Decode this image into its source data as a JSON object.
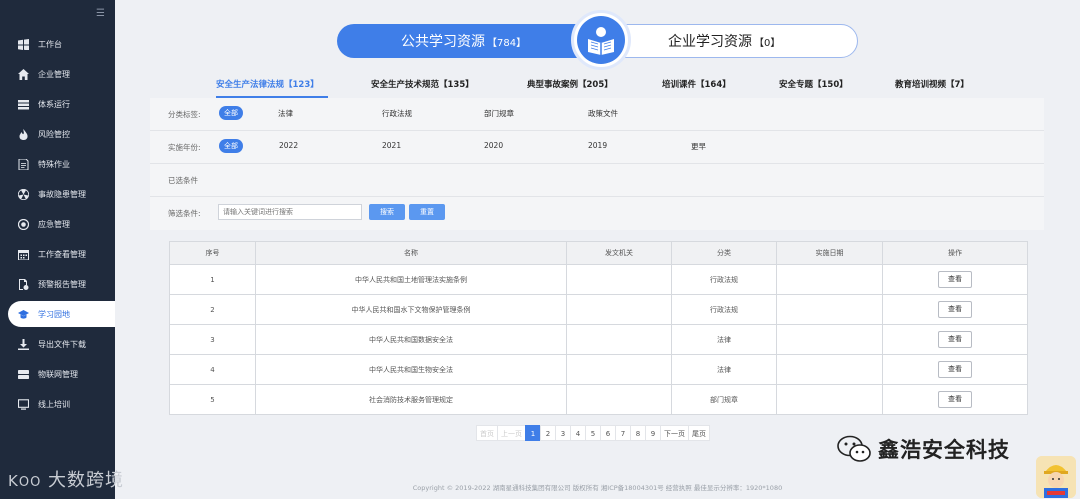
{
  "sidebar": {
    "items": [
      {
        "label": "工作台",
        "icon": "windows-icon"
      },
      {
        "label": "企业管理",
        "icon": "home-icon"
      },
      {
        "label": "体系运行",
        "icon": "stack-icon"
      },
      {
        "label": "风险管控",
        "icon": "fire-icon"
      },
      {
        "label": "特殊作业",
        "icon": "document-icon"
      },
      {
        "label": "事故隐患管理",
        "icon": "radiation-icon"
      },
      {
        "label": "应急管理",
        "icon": "target-icon"
      },
      {
        "label": "工作查看管理",
        "icon": "calendar-icon"
      },
      {
        "label": "预警报告管理",
        "icon": "report-icon"
      },
      {
        "label": "学习园地",
        "icon": "graduation-cap-icon",
        "active": true
      },
      {
        "label": "导出文件下载",
        "icon": "download-icon"
      },
      {
        "label": "物联网管理",
        "icon": "storage-icon"
      },
      {
        "label": "线上培训",
        "icon": "monitor-icon"
      }
    ]
  },
  "switcher": {
    "public_label": "公共学习资源",
    "public_count": "【784】",
    "enterprise_label": "企业学习资源",
    "enterprise_count": "【0】"
  },
  "tabs": [
    {
      "label": "安全生产法律法规【123】",
      "active": true
    },
    {
      "label": "安全生产技术规范【135】"
    },
    {
      "label": "典型事故案例【205】"
    },
    {
      "label": "培训课件【164】"
    },
    {
      "label": "安全专题【150】"
    },
    {
      "label": "教育培训视频【7】"
    }
  ],
  "filters": {
    "category_label": "分类标签:",
    "category_all": "全部",
    "category_options": [
      "法律",
      "行政法规",
      "部门规章",
      "政策文件"
    ],
    "year_label": "实施年份:",
    "year_all": "全部",
    "year_options": [
      "2022",
      "2021",
      "2020",
      "2019",
      "更早"
    ],
    "selected_label": "已选条件",
    "search_label": "筛选条件:",
    "search_placeholder": "请输入关键词进行搜索",
    "search_button": "搜索",
    "reset_button": "重置"
  },
  "table": {
    "headers": [
      "序号",
      "名称",
      "发文机关",
      "分类",
      "实施日期",
      "操作"
    ],
    "rows": [
      {
        "no": "1",
        "name": "中华人民共和国土地管理法实施条例",
        "issuer": "",
        "category": "行政法规",
        "date": "",
        "action": "查看"
      },
      {
        "no": "2",
        "name": "中华人民共和国水下文物保护管理条例",
        "issuer": "",
        "category": "行政法规",
        "date": "",
        "action": "查看"
      },
      {
        "no": "3",
        "name": "中华人民共和国数据安全法",
        "issuer": "",
        "category": "法律",
        "date": "",
        "action": "查看"
      },
      {
        "no": "4",
        "name": "中华人民共和国生物安全法",
        "issuer": "",
        "category": "法律",
        "date": "",
        "action": "查看"
      },
      {
        "no": "5",
        "name": "社会消防技术服务管理规定",
        "issuer": "",
        "category": "部门规章",
        "date": "",
        "action": "查看"
      }
    ]
  },
  "pagination": {
    "first": "首页",
    "prev": "上一页",
    "pages": [
      "1",
      "2",
      "3",
      "4",
      "5",
      "6",
      "7",
      "8",
      "9"
    ],
    "current": "1",
    "next": "下一页",
    "last": "尾页"
  },
  "footer": "Copyright © 2019-2022 湖南星通科技集团有限公司 版权所有 湘ICP备18004301号 经营执照  最佳显示分辨率：1920*1080",
  "watermarks": {
    "left": "大数跨境",
    "right": "鑫浩安全科技"
  },
  "colors": {
    "sidebar_bg": "#1f2a3c",
    "accent": "#3f7ee8",
    "page_bg": "#eef0f4"
  }
}
